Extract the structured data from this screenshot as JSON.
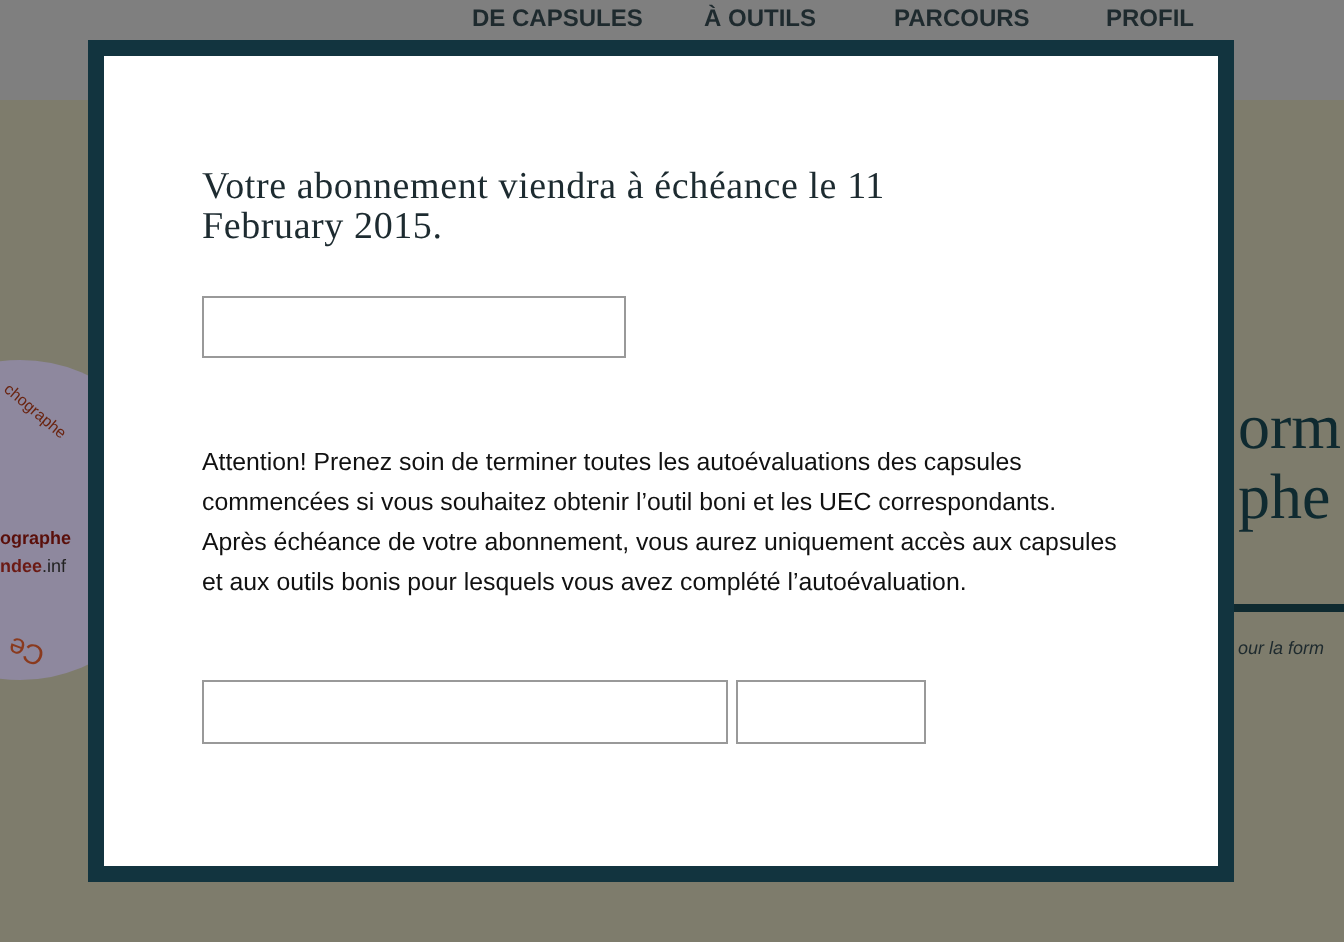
{
  "background": {
    "nav": [
      "DE CAPSULES",
      "À OUTILS",
      "PARCOURS",
      "PROFIL"
    ],
    "logo": {
      "arc_top": "chographe",
      "line_1": "ographe",
      "line_2_bold": "ndee",
      "line_2_rest": ".inf",
      "arc_bottom": "Ce"
    },
    "title_lines": [
      "orm",
      "phe"
    ],
    "tagline": "our la form"
  },
  "modal": {
    "heading": "Votre abonnement viendra à échéance le 11 February 2015.",
    "message": "Attention! Prenez soin de terminer toutes les autoévaluations des capsules commencées si vous souhaitez obtenir l’outil boni et les UEC correspondants. Après échéance de votre abonnement, vous aurez uniquement accès aux capsules et aux outils bonis pour lesquels vous avez complété l’autoévaluation."
  }
}
